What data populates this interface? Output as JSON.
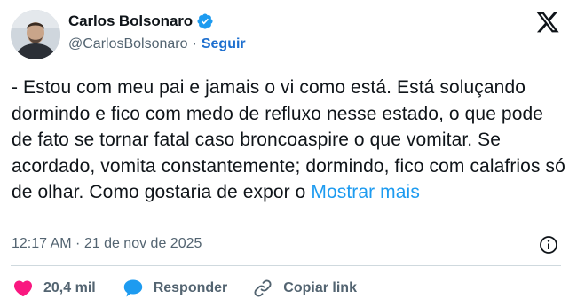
{
  "author": {
    "display_name": "Carlos Bolsonaro",
    "handle": "@CarlosBolsonaro",
    "separator": "·",
    "follow_label": "Seguir",
    "verified": true
  },
  "post": {
    "text": "- Estou com meu pai e jamais o vi como está. Está soluçando dormindo e fico com medo de refluxo nesse estado, o que pode de fato se tornar fatal caso broncoaspire o que vomitar. Se acordado, vomita constantemente; dormindo, fico com calafrios só de olhar. Como gostaria de expor o ",
    "show_more_label": "Mostrar mais",
    "timestamp": "12:17 AM · 21 de nov de 2025"
  },
  "actions": {
    "like_count": "20,4 mil",
    "reply_label": "Responder",
    "copy_link_label": "Copiar link"
  },
  "colors": {
    "accent": "#1d9bf0",
    "verified_badge": "#1d9bf0",
    "like_heart": "#f91880",
    "reply_bubble": "#1d9bf0",
    "secondary_text": "#536471",
    "primary_text": "#0f1419"
  },
  "icons": {
    "verified": "verified-badge-icon",
    "brand": "x-logo-icon",
    "info": "info-icon",
    "like": "heart-icon",
    "reply": "speech-bubble-icon",
    "copy_link": "link-icon"
  }
}
